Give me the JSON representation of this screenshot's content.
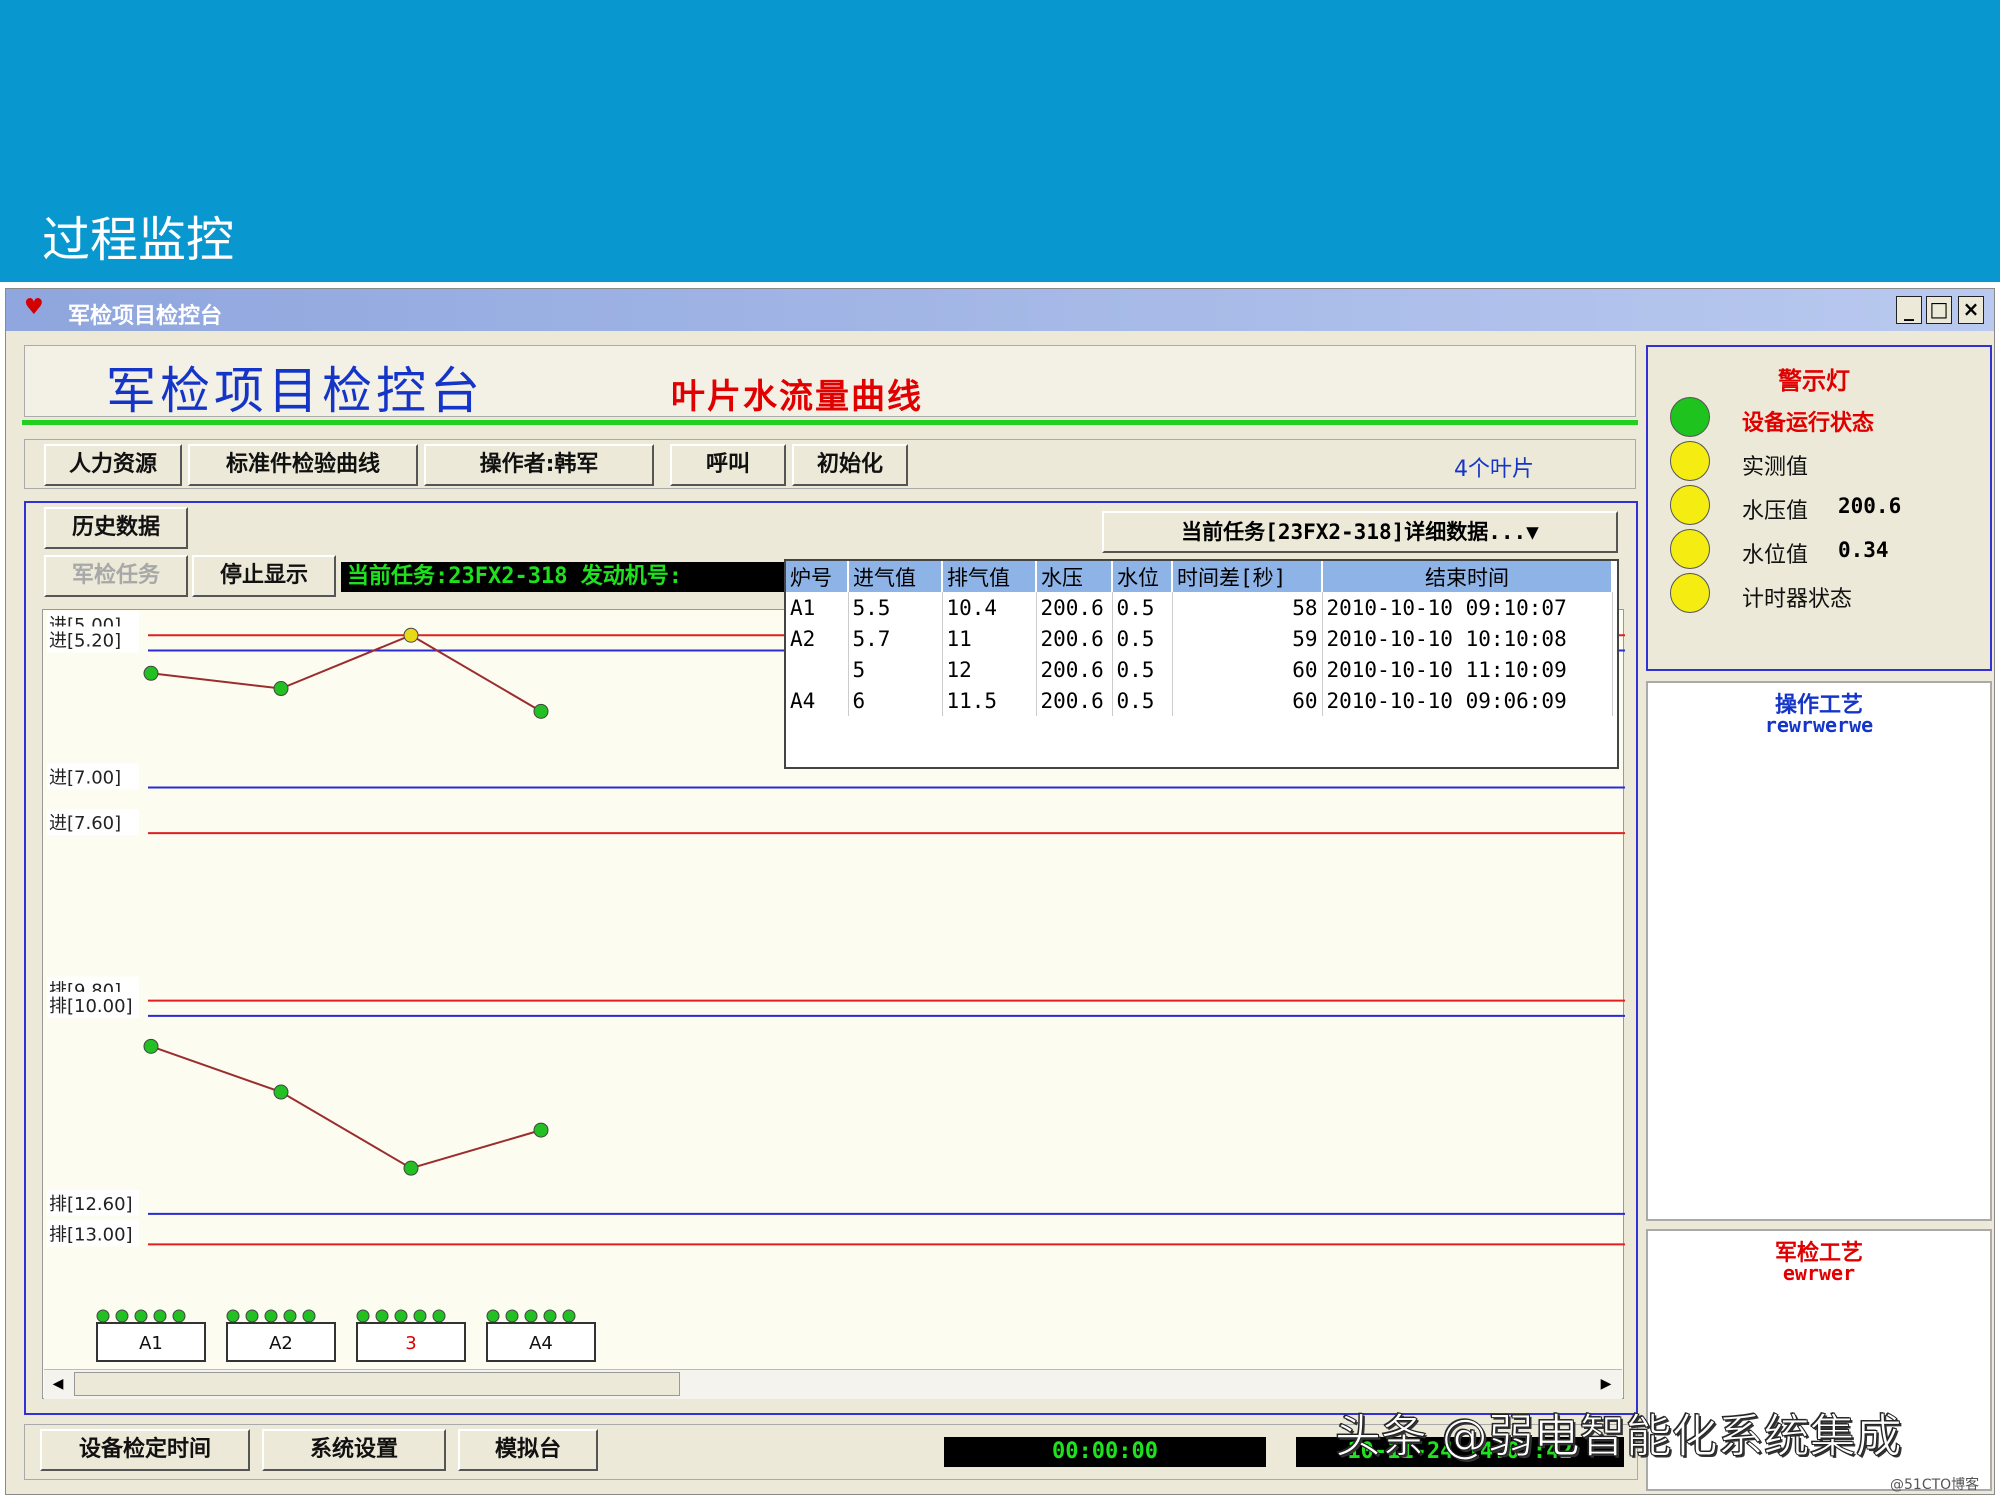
{
  "slide": {
    "title": "过程监控"
  },
  "window": {
    "title": "军检项目检控台",
    "min": "_",
    "max": "□",
    "close": "×"
  },
  "header": {
    "main_title": "军检项目检控台",
    "sub_title": "叶片水流量曲线"
  },
  "toolbar": {
    "hr": "人力资源",
    "std_curve": "标准件检验曲线",
    "operator": "操作者:韩军",
    "call": "呼叫",
    "init": "初始化",
    "blade_count": "4个叶片"
  },
  "chart_controls": {
    "history": "历史数据",
    "mil_task": "军检任务",
    "stop_display": "停止显示",
    "status_text": "当前任务:23FX2-318  发动机号:",
    "task_dropdown": "当前任务[23FX2-318]详细数据...▼"
  },
  "table": {
    "headers": [
      "炉号",
      "进气值",
      "排气值",
      "水压",
      "水位",
      "时间差[秒]",
      "结束时间"
    ],
    "rows": [
      [
        "A1",
        "5.5",
        "10.4",
        "200.6",
        "0.5",
        "58",
        "2010-10-10 09:10:07"
      ],
      [
        "A2",
        "5.7",
        "11",
        "200.6",
        "0.5",
        "59",
        "2010-10-10 10:10:08"
      ],
      [
        "",
        "5",
        "12",
        "200.6",
        "0.5",
        "60",
        "2010-10-10 11:10:09"
      ],
      [
        "A4",
        "6",
        "11.5",
        "200.6",
        "0.5",
        "60",
        "2010-10-10 09:06:09"
      ]
    ]
  },
  "chart_data": {
    "type": "line",
    "y_inverted": true,
    "ylim": [
      4.8,
      13.6
    ],
    "reference_lines": [
      {
        "label": "进[5.00]",
        "value": 5.0,
        "color": "#e02020"
      },
      {
        "label": "进[5.20]",
        "value": 5.2,
        "color": "#2b2bd6"
      },
      {
        "label": "进[7.00]",
        "value": 7.0,
        "color": "#2b2bd6"
      },
      {
        "label": "进[7.60]",
        "value": 7.6,
        "color": "#e02020"
      },
      {
        "label": "排[9.80]",
        "value": 9.8,
        "color": "#e02020"
      },
      {
        "label": "排[10.00]",
        "value": 10.0,
        "color": "#2b2bd6"
      },
      {
        "label": "排[12.60]",
        "value": 12.6,
        "color": "#2b2bd6"
      },
      {
        "label": "排[13.00]",
        "value": 13.0,
        "color": "#e02020"
      }
    ],
    "categories": [
      "A1",
      "A2",
      "3",
      "A4"
    ],
    "series": [
      {
        "values": [
          5.5,
          5.7,
          5.0,
          6.0
        ],
        "point_colors": [
          "#22c022",
          "#22c022",
          "#e8d81a",
          "#22c022"
        ]
      },
      {
        "values": [
          10.4,
          11.0,
          12.0,
          11.5
        ],
        "point_colors": [
          "#22c022",
          "#22c022",
          "#22c022",
          "#22c022"
        ]
      }
    ],
    "blade_label_colors": [
      "#111111",
      "#111111",
      "#e00000",
      "#111111"
    ]
  },
  "alarm": {
    "title": "警示灯",
    "items": [
      {
        "label": "设备运行状态",
        "value": "",
        "color": "#1ec31e",
        "label_color": "#e00000"
      },
      {
        "label": "实测值",
        "value": "",
        "color": "#f5ec12",
        "label_color": "#111111"
      },
      {
        "label": "水压值",
        "value": "200.6",
        "color": "#f5ec12",
        "label_color": "#111111"
      },
      {
        "label": "水位值",
        "value": "0.34",
        "color": "#f5ec12",
        "label_color": "#111111"
      },
      {
        "label": "计时器状态",
        "value": "",
        "color": "#f5ec12",
        "label_color": "#111111"
      }
    ]
  },
  "process": {
    "title": "操作工艺",
    "value": "rewrwerwe"
  },
  "military": {
    "title": "军检工艺",
    "value": "ewrwer"
  },
  "bottom": {
    "check_time": "设备检定时间",
    "settings": "系统设置",
    "simulator": "模拟台",
    "timer": "00:00:00",
    "clock": "10-11-24 14:07:42"
  },
  "watermark": "头条 @弱电智能化系统集成",
  "credit": "@51CTO博客"
}
